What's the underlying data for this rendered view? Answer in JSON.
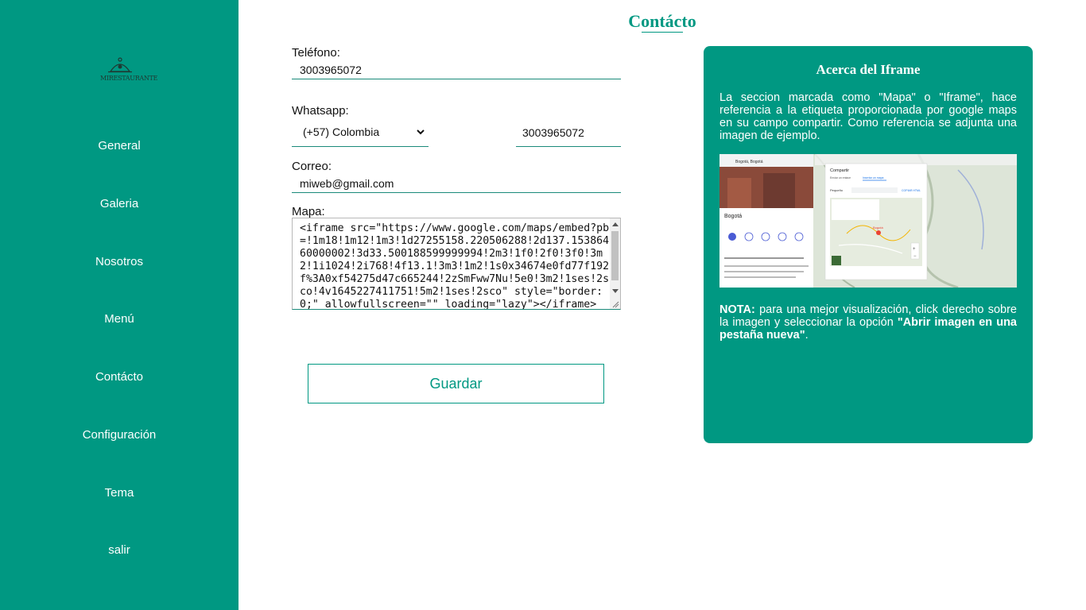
{
  "sidebar": {
    "logo_text": "MIRESTAURANTE",
    "items": [
      {
        "label": "General"
      },
      {
        "label": "Galeria"
      },
      {
        "label": "Nosotros"
      },
      {
        "label": "Menú"
      },
      {
        "label": "Contácto"
      },
      {
        "label": "Configuración"
      },
      {
        "label": "Tema"
      },
      {
        "label": "salir"
      }
    ]
  },
  "page": {
    "title": "Contácto"
  },
  "form": {
    "phone_label": "Teléfono:",
    "phone_value": "3003965072",
    "whatsapp_label": "Whatsapp:",
    "country_selected": "(+57) Colombia",
    "whatsapp_value": "3003965072",
    "email_label": "Correo:",
    "email_value": "miweb@gmail.com",
    "map_label": "Mapa:",
    "map_value": "<iframe src=\"https://www.google.com/maps/embed?pb=!1m18!1m12!1m3!1d27255158.220506288!2d137.15386460000002!3d33.500188599999994!2m3!1f0!2f0!3f0!3m2!1i1024!2i768!4f13.1!3m3!1m2!1s0x34674e0fd77f192f%3A0xf54275d47c665244!2zSmFww7Nu!5e0!3m2!1ses!2sco!4v1645227411751!5m2!1ses!2sco\" style=\"border:0;\" allowfullscreen=\"\" loading=\"lazy\"></iframe>",
    "save_label": "Guardar"
  },
  "info": {
    "title": "Acerca del Iframe",
    "description": "La seccion marcada como \"Mapa\" o \"Iframe\", hace referencia a la etiqueta proporcionada por google maps en su campo compartir. Como referencia se adjunta una imagen de ejemplo.",
    "note_bold": "NOTA:",
    "note_text": " para una mejor visualización, click derecho sobre la imagen y seleccionar la opción ",
    "note_option": "\"Abrir imagen en una pestaña nueva\"",
    "note_end": ".",
    "example": {
      "search_text": "Bogotá, Bogotá",
      "place_name": "Bogotá",
      "dialog_title": "Compartir",
      "tab_send": "Enviar un enlace",
      "tab_embed": "Insertar un mapa",
      "size_label": "Pequeño",
      "copy_label": "COPIAR HTML",
      "pin_label": "Bogotá"
    }
  },
  "colors": {
    "primary": "#009882",
    "text_light": "#ffffff"
  }
}
